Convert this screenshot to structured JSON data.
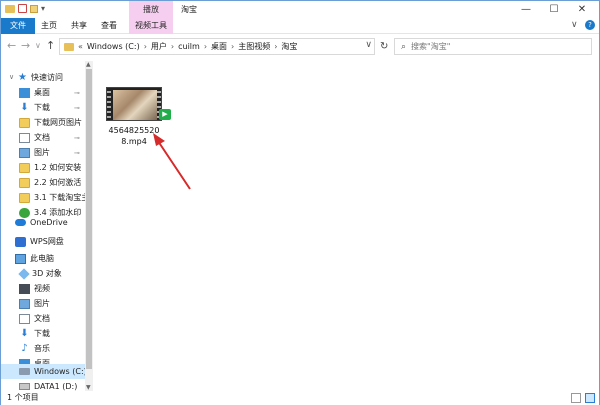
{
  "titlebar": {
    "context_tab": "播放",
    "window_title": "淘宝",
    "minimize": "—",
    "maximize": "☐",
    "close": "✕"
  },
  "ribbon": {
    "tabs": [
      "文件",
      "主页",
      "共享",
      "查看",
      "视频工具"
    ],
    "expand": "∨",
    "help": "?"
  },
  "address": {
    "back": "←",
    "forward": "→",
    "recent": "∨",
    "up": "↑",
    "overflow": "«",
    "crumbs": [
      "Windows (C:)",
      "用户",
      "cuilm",
      "桌面",
      "主图视频",
      "淘宝"
    ],
    "dropdown": "∨",
    "refresh": "↻",
    "search_placeholder": "搜索\"淘宝\""
  },
  "sidebar": {
    "items": [
      {
        "label": "快速访问",
        "icon": "star-icon"
      },
      {
        "label": "桌面",
        "icon": "desktop-icon",
        "pinned": true
      },
      {
        "label": "下载",
        "icon": "download-icon",
        "pinned": true
      },
      {
        "label": "下载网页图片",
        "icon": "folder-icon",
        "pinned": true
      },
      {
        "label": "文档",
        "icon": "document-icon",
        "pinned": true
      },
      {
        "label": "图片",
        "icon": "picture-icon",
        "pinned": true
      },
      {
        "label": "1.2 如何安装",
        "icon": "folder-icon"
      },
      {
        "label": "2.2 如何激活",
        "icon": "folder-icon"
      },
      {
        "label": "3.1 下载淘宝主图",
        "icon": "folder-icon"
      },
      {
        "label": "3.4 添加水印",
        "icon": "app-icon"
      },
      {
        "label": "OneDrive",
        "icon": "onedrive-icon"
      },
      {
        "label": "WPS网盘",
        "icon": "wps-icon"
      },
      {
        "label": "此电脑",
        "icon": "computer-icon"
      },
      {
        "label": "3D 对象",
        "icon": "3d-objects-icon"
      },
      {
        "label": "视频",
        "icon": "video-icon"
      },
      {
        "label": "图片",
        "icon": "picture-icon"
      },
      {
        "label": "文档",
        "icon": "document-icon"
      },
      {
        "label": "下载",
        "icon": "download-icon"
      },
      {
        "label": "音乐",
        "icon": "music-icon"
      },
      {
        "label": "桌面",
        "icon": "desktop-icon"
      },
      {
        "label": "Windows (C:)",
        "icon": "drive-icon"
      },
      {
        "label": "DATA1 (D:)",
        "icon": "drive-icon"
      }
    ],
    "pin_glyph": "⊸"
  },
  "file": {
    "name": "45648255208.mp4",
    "badge": "▶"
  },
  "status": {
    "count": "1 个项目"
  }
}
